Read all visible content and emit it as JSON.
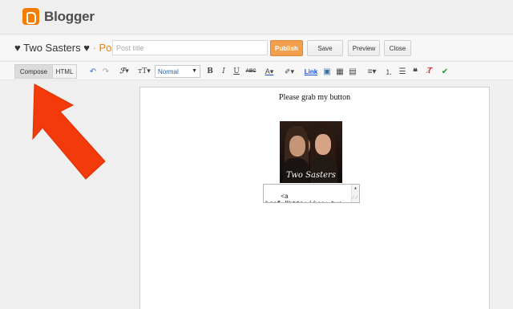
{
  "app": {
    "name": "Blogger"
  },
  "header": {
    "blog_name": "♥ Two Sasters ♥",
    "separator": " · ",
    "section": "Post",
    "post_title_placeholder": "Post title",
    "post_title_value": "",
    "publish_label": "Publish",
    "save_label": "Save",
    "preview_label": "Preview",
    "close_label": "Close"
  },
  "toolbar": {
    "compose_label": "Compose",
    "html_label": "HTML",
    "font_size_label": "Normal",
    "link_label": "Link",
    "icons": [
      "undo-icon",
      "redo-icon",
      "font-family-icon",
      "font-size-icon",
      "bold-icon",
      "italic-icon",
      "underline-icon",
      "strikethrough-icon",
      "text-color-icon",
      "highlight-icon",
      "link-icon",
      "image-icon",
      "video-icon",
      "jump-break-icon",
      "align-icon",
      "numbered-list-icon",
      "bullet-list-icon",
      "quote-icon",
      "remove-formatting-icon",
      "spellcheck-icon"
    ]
  },
  "editor": {
    "heading_text": "Please grab my button",
    "image_caption": "Two Sasters",
    "code_text": "<a\nhref=\"http://www.two"
  },
  "colors": {
    "accent": "#f57d00",
    "publish": "#f29e4c",
    "arrow": "#f23a0a"
  }
}
